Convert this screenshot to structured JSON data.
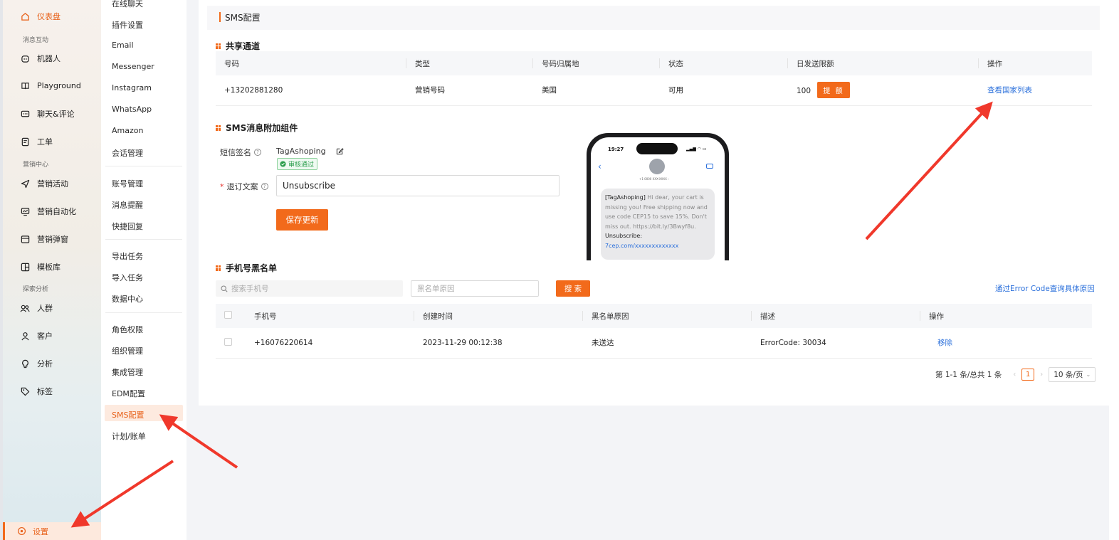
{
  "nav": {
    "dashboard": "仪表盘",
    "group_messaging": "消息互动",
    "robot": "机器人",
    "playground": "Playground",
    "chat": "聊天&评论",
    "ticket": "工单",
    "group_marketing": "营销中心",
    "campaign": "营销活动",
    "automation": "营销自动化",
    "popup": "营销弹窗",
    "templates": "模板库",
    "group_analytics": "探索分析",
    "audience": "人群",
    "customers": "客户",
    "analysis": "分析",
    "tags": "标签",
    "settings": "设置"
  },
  "subnav": {
    "items": [
      "在线聊天",
      "插件设置",
      "Email",
      "Messenger",
      "Instagram",
      "WhatsApp",
      "Amazon",
      "会话管理",
      "账号管理",
      "消息提醒",
      "快捷回复",
      "导出任务",
      "导入任务",
      "数据中心",
      "角色权限",
      "组织管理",
      "集成管理",
      "EDM配置",
      "SMS配置",
      "计划/账单"
    ]
  },
  "page": {
    "title": "SMS配置"
  },
  "shared": {
    "title": "共享通道",
    "headers": [
      "号码",
      "类型",
      "号码归属地",
      "状态",
      "日发送限额",
      "操作"
    ],
    "row": {
      "number": "+13202881280",
      "type": "营销号码",
      "location": "美国",
      "status": "可用",
      "limit": "100",
      "raise_btn": "提 额",
      "action": "查看国家列表"
    }
  },
  "addon": {
    "title": "SMS消息附加组件",
    "sign_label": "短信签名",
    "sign_value": "TagAshoping",
    "sign_status": "审核通过",
    "unsub_required": "*",
    "unsub_label": "退订文案",
    "unsub_value": "Unsubscribe",
    "save_btn": "保存更新"
  },
  "phone": {
    "time": "19:27",
    "contact": "+1 0000 XXX-XXXX ›",
    "msg_brand": "[TagAshoping]",
    "msg_body": " Hi dear, your cart is missing you! Free shipping now and use code CEP15 to save 15%. Don't miss out. https://bit.ly/3Bwyf8u. ",
    "msg_unsub": "Unsubscribe:",
    "msg_link": " 7cep.com/xxxxxxxxxxxxx"
  },
  "blacklist": {
    "title": "手机号黑名单",
    "search_placeholder": "搜索手机号",
    "reason_placeholder": "黑名单原因",
    "search_btn": "搜 索",
    "error_link": "通过Error Code查询具体原因",
    "headers": [
      "手机号",
      "创建时间",
      "黑名单原因",
      "描述",
      "操作"
    ],
    "rows": [
      {
        "phone": "+16076220614",
        "created": "2023-11-29 00:12:38",
        "reason": "未送达",
        "desc": "ErrorCode: 30034",
        "action": "移除"
      }
    ],
    "pager": {
      "summary": "第 1-1 条/总共 1 条",
      "current": "1",
      "page_size": "10 条/页"
    }
  },
  "colors": {
    "accent": "#f26a1b",
    "link": "#2a6fdb",
    "success": "#2fb36a",
    "arrow": "#f0382b"
  }
}
